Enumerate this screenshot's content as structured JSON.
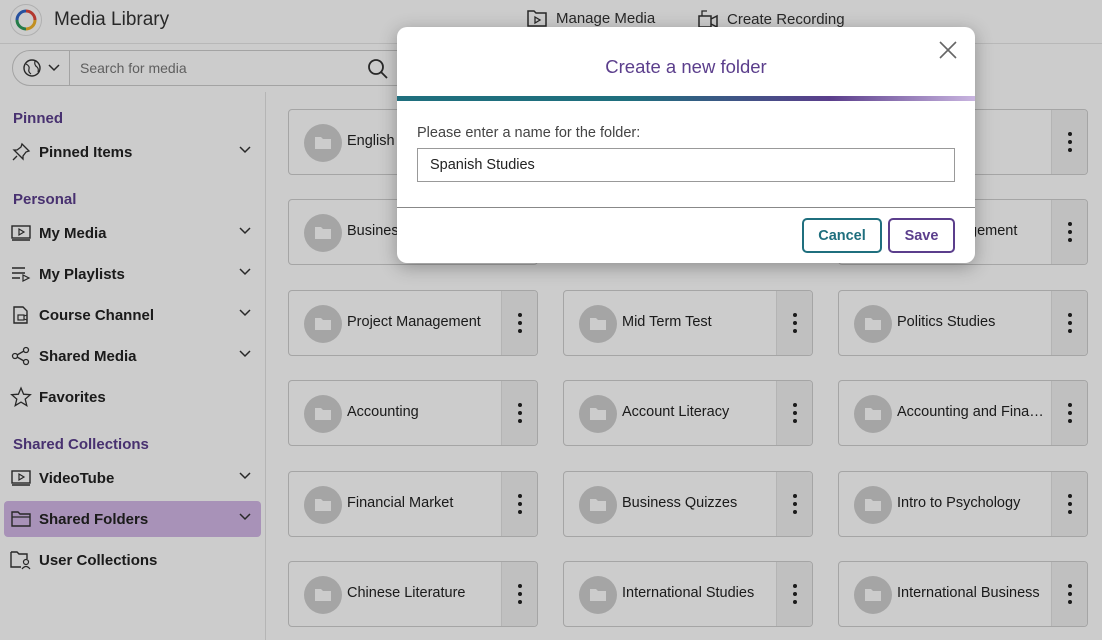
{
  "header": {
    "app_title": "Media Library",
    "manage_media": "Manage Media",
    "create_recording": "Create Recording"
  },
  "search": {
    "placeholder": "Search for media"
  },
  "sidebar": {
    "pinned_title": "Pinned",
    "pinned_items": "Pinned Items",
    "personal_title": "Personal",
    "my_media": "My Media",
    "my_playlists": "My Playlists",
    "course_channel": "Course Channel",
    "shared_media": "Shared Media",
    "favorites": "Favorites",
    "shared_collections_title": "Shared Collections",
    "videotube": "VideoTube",
    "shared_folders": "Shared Folders",
    "user_collections": "User Collections"
  },
  "folders": [
    "English",
    "",
    "",
    "Business",
    "",
    "Management",
    "Project Management",
    "Mid Term Test",
    "Politics Studies",
    "Accounting",
    "Account Literacy",
    "Accounting and Finance",
    "Financial Market",
    "Business Quizzes",
    "Intro to Psychology",
    "Chinese Literature",
    "International Studies",
    "International Business"
  ],
  "folders_visible": {
    "r0c0": "English",
    "r1c0": "Business",
    "r1c2": "gement",
    "r2c0": "Project Management",
    "r2c1": "Mid Term Test",
    "r2c2": "Politics Studies",
    "r3c0": "Accounting",
    "r3c1": "Account Literacy",
    "r3c2": "Accounting and Finance",
    "r4c0": "Financial Market",
    "r4c1": "Business Quizzes",
    "r4c2": "Intro to Psychology",
    "r5c0": "Chinese Literature",
    "r5c1": "International Studies",
    "r5c2": "International Business"
  },
  "modal": {
    "title": "Create a new folder",
    "label": "Please enter a name for the folder:",
    "input_value": "Spanish Studies",
    "cancel": "Cancel",
    "save": "Save"
  },
  "colors": {
    "accent_purple": "#5b3e8c",
    "accent_teal": "#1f6f7e",
    "active_item": "#d3b7e6"
  }
}
